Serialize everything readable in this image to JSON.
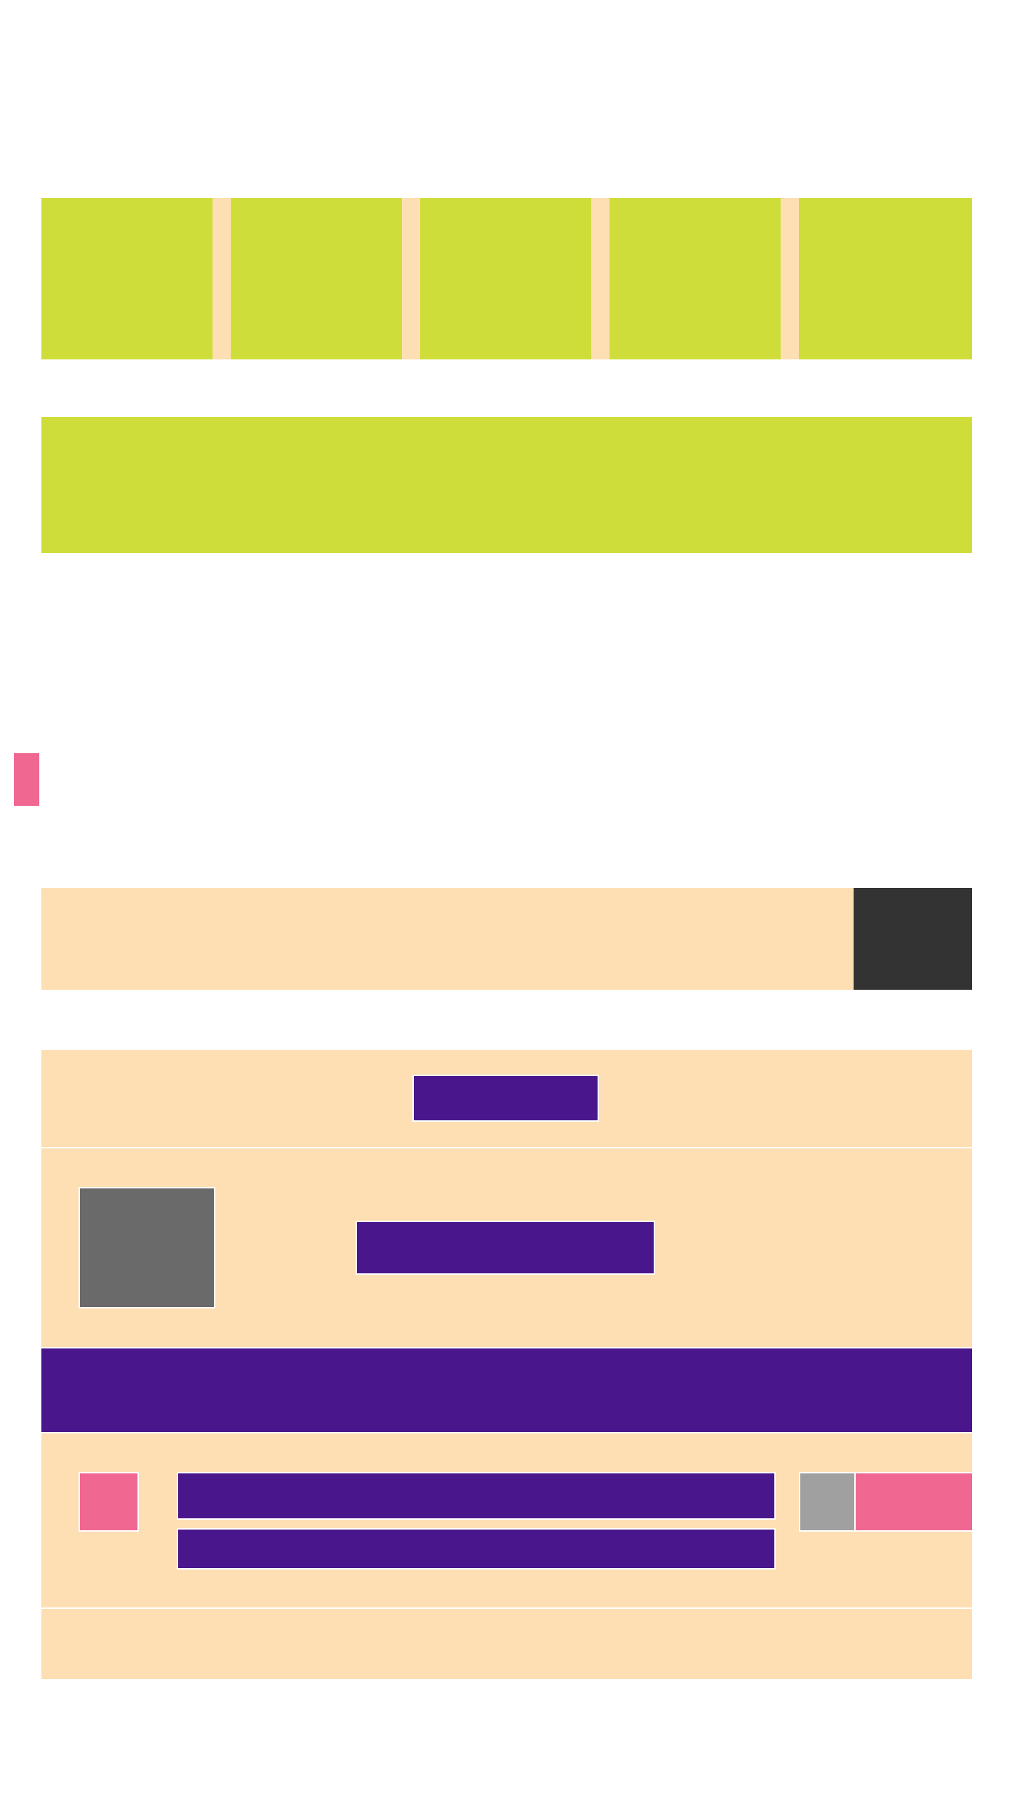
{
  "theme": {
    "lime": "#cfdd3a",
    "peach": "#fddfb3",
    "purple": "#4a168c",
    "pink": "#f06792",
    "dark": "#333333",
    "gray": "#6a6a6a",
    "light_gray": "#a0a0a0",
    "background": "#ffffff"
  },
  "carousel": {
    "slides": [
      "",
      "",
      "",
      "",
      ""
    ]
  },
  "banner": {
    "text": ""
  },
  "side_tab": {
    "label": ""
  },
  "promo_bar": {
    "text": "",
    "action": ""
  },
  "card_header": {
    "button": ""
  },
  "card_media": {
    "thumbnail_alt": "",
    "button": ""
  },
  "card_strip": {
    "text": ""
  },
  "list_item": {
    "title": "",
    "subtitle": "",
    "badge": "",
    "toggle": "",
    "action": ""
  },
  "card_footer": {
    "text": ""
  }
}
